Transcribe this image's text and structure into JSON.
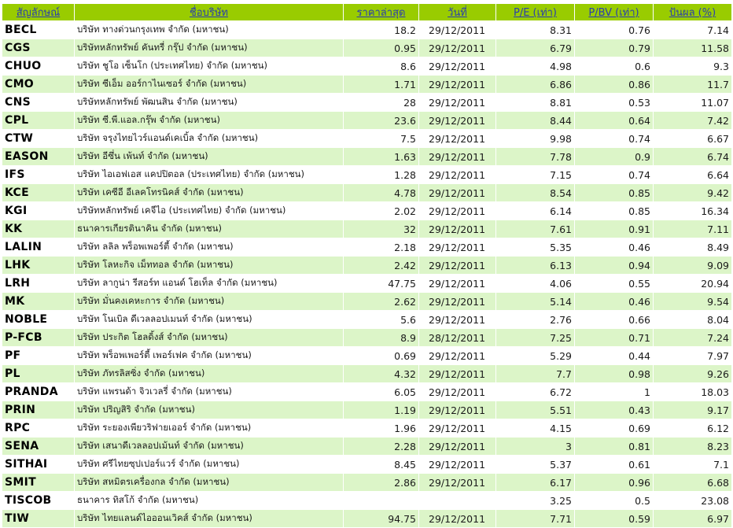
{
  "headers": [
    "สัญลักษณ์",
    "ชื่อบริษัท",
    "ราคาล่าสุด",
    "วันที่",
    "P/E (เท่า)",
    "P/BV (เท่า)",
    "ปันผล (%)"
  ],
  "rows": [
    {
      "symbol": "BECL",
      "company": "บริษัท ทางด่วนกรุงเทพ จำกัด (มหาชน)",
      "price": "18.2",
      "date": "29/12/2011",
      "pe": "8.31",
      "pbv": "0.76",
      "dividend": "7.14"
    },
    {
      "symbol": "CGS",
      "company": "บริษัทหลักทรัพย์ คันทรี่ กรุ๊ป จำกัด (มหาชน)",
      "price": "0.95",
      "date": "29/12/2011",
      "pe": "6.79",
      "pbv": "0.79",
      "dividend": "11.58"
    },
    {
      "symbol": "CHUO",
      "company": "บริษัท ชูโอ เซ็นโก (ประเทศไทย) จำกัด (มหาชน)",
      "price": "8.6",
      "date": "29/12/2011",
      "pe": "4.98",
      "pbv": "0.6",
      "dividend": "9.3"
    },
    {
      "symbol": "CMO",
      "company": "บริษัท ซีเอ็ม ออร์กาไนเซอร์ จำกัด (มหาชน)",
      "price": "1.71",
      "date": "29/12/2011",
      "pe": "6.86",
      "pbv": "0.86",
      "dividend": "11.7"
    },
    {
      "symbol": "CNS",
      "company": "บริษัทหลักทรัพย์ พัฒนสิน จำกัด (มหาชน)",
      "price": "28",
      "date": "29/12/2011",
      "pe": "8.81",
      "pbv": "0.53",
      "dividend": "11.07"
    },
    {
      "symbol": "CPL",
      "company": "บริษัท ซี.พี.แอล.กรุ๊พ จำกัด (มหาชน)",
      "price": "23.6",
      "date": "29/12/2011",
      "pe": "8.44",
      "pbv": "0.64",
      "dividend": "7.42"
    },
    {
      "symbol": "CTW",
      "company": "บริษัท จรุงไทยไวร์แอนด์เคเบิ้ล จำกัด (มหาชน)",
      "price": "7.5",
      "date": "29/12/2011",
      "pe": "9.98",
      "pbv": "0.74",
      "dividend": "6.67"
    },
    {
      "symbol": "EASON",
      "company": "บริษัท อีซึ่น เพ้นท์ จำกัด (มหาชน)",
      "price": "1.63",
      "date": "29/12/2011",
      "pe": "7.78",
      "pbv": "0.9",
      "dividend": "6.74"
    },
    {
      "symbol": "IFS",
      "company": "บริษัท ไอเอฟเอส แคปปิตอล (ประเทศไทย) จำกัด (มหาชน)",
      "price": "1.28",
      "date": "29/12/2011",
      "pe": "7.15",
      "pbv": "0.74",
      "dividend": "6.64"
    },
    {
      "symbol": "KCE",
      "company": "บริษัท เคซีอี อีเลคโทรนิคส์ จำกัด (มหาชน)",
      "price": "4.78",
      "date": "29/12/2011",
      "pe": "8.54",
      "pbv": "0.85",
      "dividend": "9.42"
    },
    {
      "symbol": "KGI",
      "company": "บริษัทหลักทรัพย์ เคจีไอ (ประเทศไทย) จำกัด (มหาชน)",
      "price": "2.02",
      "date": "29/12/2011",
      "pe": "6.14",
      "pbv": "0.85",
      "dividend": "16.34"
    },
    {
      "symbol": "KK",
      "company": "ธนาคารเกียรตินาคิน จำกัด (มหาชน)",
      "price": "32",
      "date": "29/12/2011",
      "pe": "7.61",
      "pbv": "0.91",
      "dividend": "7.11"
    },
    {
      "symbol": "LALIN",
      "company": "บริษัท ลลิล พร็อพเพอร์ตี้ จำกัด (มหาชน)",
      "price": "2.18",
      "date": "29/12/2011",
      "pe": "5.35",
      "pbv": "0.46",
      "dividend": "8.49"
    },
    {
      "symbol": "LHK",
      "company": "บริษัท โลหะกิจ เม็ททอล จำกัด (มหาชน)",
      "price": "2.42",
      "date": "29/12/2011",
      "pe": "6.13",
      "pbv": "0.94",
      "dividend": "9.09"
    },
    {
      "symbol": "LRH",
      "company": "บริษัท ลากูน่า รีสอร์ท แอนด์ โฮเท็ล จำกัด (มหาชน)",
      "price": "47.75",
      "date": "29/12/2011",
      "pe": "4.06",
      "pbv": "0.55",
      "dividend": "20.94"
    },
    {
      "symbol": "MK",
      "company": "บริษัท มั่นคงเคหะการ จำกัด (มหาชน)",
      "price": "2.62",
      "date": "29/12/2011",
      "pe": "5.14",
      "pbv": "0.46",
      "dividend": "9.54"
    },
    {
      "symbol": "NOBLE",
      "company": "บริษัท โนเบิล ดีเวลลอปเมนท์ จำกัด (มหาชน)",
      "price": "5.6",
      "date": "29/12/2011",
      "pe": "2.76",
      "pbv": "0.66",
      "dividend": "8.04"
    },
    {
      "symbol": "P-FCB",
      "company": "บริษัท ประกิต โฮลดิ้งส์ จำกัด (มหาชน)",
      "price": "8.9",
      "date": "28/12/2011",
      "pe": "7.25",
      "pbv": "0.71",
      "dividend": "7.24"
    },
    {
      "symbol": "PF",
      "company": "บริษัท พร็อพเพอร์ตี้ เพอร์เฟค จำกัด (มหาชน)",
      "price": "0.69",
      "date": "29/12/2011",
      "pe": "5.29",
      "pbv": "0.44",
      "dividend": "7.97"
    },
    {
      "symbol": "PL",
      "company": "บริษัท ภัทรลิสซิ่ง จำกัด (มหาชน)",
      "price": "4.32",
      "date": "29/12/2011",
      "pe": "7.7",
      "pbv": "0.98",
      "dividend": "9.26"
    },
    {
      "symbol": "PRANDA",
      "company": "บริษัท แพรนด้า จิวเวลรี่ จำกัด (มหาชน)",
      "price": "6.05",
      "date": "29/12/2011",
      "pe": "6.72",
      "pbv": "1",
      "dividend": "18.03"
    },
    {
      "symbol": "PRIN",
      "company": "บริษัท ปริญสิริ จำกัด (มหาชน)",
      "price": "1.19",
      "date": "29/12/2011",
      "pe": "5.51",
      "pbv": "0.43",
      "dividend": "9.17"
    },
    {
      "symbol": "RPC",
      "company": "บริษัท ระยองเพียวริฟายเออร์ จำกัด (มหาชน)",
      "price": "1.96",
      "date": "29/12/2011",
      "pe": "4.15",
      "pbv": "0.69",
      "dividend": "6.12"
    },
    {
      "symbol": "SENA",
      "company": "บริษัท เสนาดีเวลลอปเม้นท์ จำกัด (มหาชน)",
      "price": "2.28",
      "date": "29/12/2011",
      "pe": "3",
      "pbv": "0.81",
      "dividend": "8.23"
    },
    {
      "symbol": "SITHAI",
      "company": "บริษัท ศรีไทยซุปเปอร์แวร์ จำกัด (มหาชน)",
      "price": "8.45",
      "date": "29/12/2011",
      "pe": "5.37",
      "pbv": "0.61",
      "dividend": "7.1"
    },
    {
      "symbol": "SMIT",
      "company": "บริษัท สหมิตรเครื่องกล จำกัด (มหาชน)",
      "price": "2.86",
      "date": "29/12/2011",
      "pe": "6.17",
      "pbv": "0.96",
      "dividend": "6.68"
    },
    {
      "symbol": "TISCOB",
      "company": "ธนาคาร ทิสโก้ จำกัด (มหาชน)",
      "price": "",
      "date": "",
      "pe": "3.25",
      "pbv": "0.5",
      "dividend": "23.08"
    },
    {
      "symbol": "TIW",
      "company": "บริษัท ไทยแลนด์ไอออนเวิคส์ จำกัด (มหาชน)",
      "price": "94.75",
      "date": "29/12/2011",
      "pe": "7.71",
      "pbv": "0.59",
      "dividend": "6.97"
    }
  ]
}
